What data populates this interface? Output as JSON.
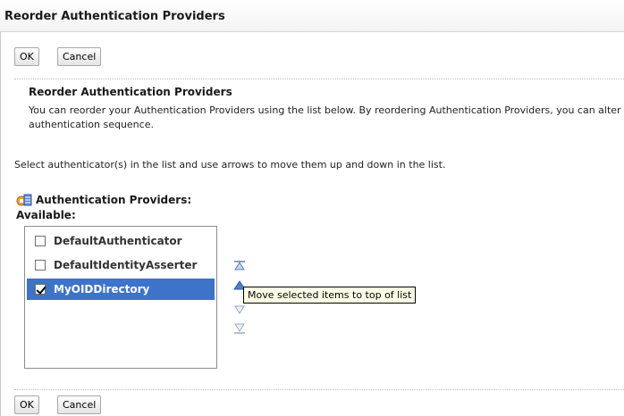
{
  "window": {
    "title": "Reorder Authentication Providers"
  },
  "top_buttons": {
    "ok": "OK",
    "cancel": "Cancel"
  },
  "section": {
    "title": "Reorder Authentication Providers",
    "description": "You can reorder your Authentication Providers using the list below. By reordering Authentication Providers, you can alter the authentication sequence."
  },
  "instruction": "Select authenticator(s) in the list and use arrows to move them up and down in the list.",
  "providers": {
    "heading": "Authentication Providers:",
    "available_label": "Available:",
    "items": [
      {
        "label": "DefaultAuthenticator",
        "checked": false,
        "selected": false
      },
      {
        "label": "DefaultIdentityAsserter",
        "checked": false,
        "selected": false
      },
      {
        "label": "MyOIDDirectory",
        "checked": true,
        "selected": true
      }
    ]
  },
  "arrows": {
    "move_top": "move-to-top-icon",
    "move_up": "move-up-icon",
    "move_down": "move-down-icon",
    "move_bottom": "move-to-bottom-icon"
  },
  "tooltip": "Move selected items to top of list",
  "bottom_buttons": {
    "ok": "OK",
    "cancel": "Cancel"
  },
  "colors": {
    "selection": "#3d73c8",
    "arrow": "#9aaac2",
    "tooltip_bg": "#ffffe6"
  }
}
